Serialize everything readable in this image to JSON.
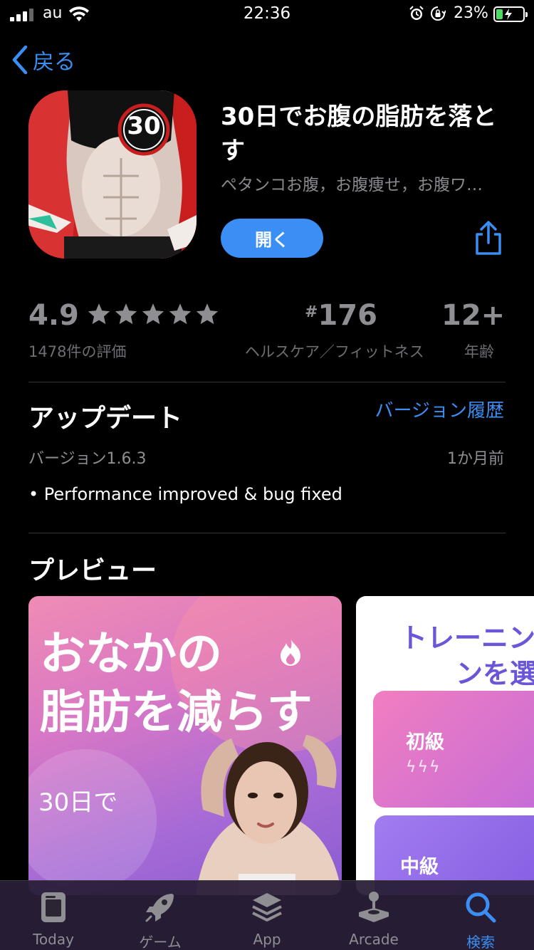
{
  "status_bar": {
    "carrier": "au",
    "time": "22:36",
    "battery_percent": "23%",
    "battery_level": 0.23,
    "icons": [
      "signal-icon",
      "wifi-icon",
      "alarm-icon",
      "rotation-lock-icon",
      "battery-charging-icon"
    ]
  },
  "nav": {
    "back_label": "戻る"
  },
  "app": {
    "icon_badge": "30",
    "title": "30日でお腹の脂肪を落とす",
    "subtitle": "ペタンコお腹，お腹痩せ，お腹ワ…",
    "open_label": "開く"
  },
  "stats": {
    "rating": "4.9",
    "stars": 5,
    "rating_count": "1478件の評価",
    "rank_hash": "#",
    "rank": "176",
    "rank_category": "ヘルスケア／フィットネス",
    "age": "12+",
    "age_label": "年齢"
  },
  "update": {
    "title": "アップデート",
    "history_link": "バージョン履歴",
    "version": "バージョン1.6.3",
    "updated": "1か月前",
    "notes": "• Performance improved & bug fixed"
  },
  "preview": {
    "title": "プレビュー",
    "card1": {
      "line1": "おなかの",
      "line2": "脂肪を減らす",
      "days": "30日で"
    },
    "card2": {
      "line1": "トレーニン",
      "line2": "ンを選",
      "level1": "初級",
      "level2": "中級",
      "bolts": "ϟϟϟ"
    }
  },
  "tabs": [
    {
      "label": "Today",
      "icon": "today-icon",
      "active": false
    },
    {
      "label": "ゲーム",
      "icon": "rocket-icon",
      "active": false
    },
    {
      "label": "App",
      "icon": "layers-icon",
      "active": false
    },
    {
      "label": "Arcade",
      "icon": "joystick-icon",
      "active": false
    },
    {
      "label": "検索",
      "icon": "search-icon",
      "active": true
    }
  ],
  "colors": {
    "accent": "#3b8ef3",
    "background": "#000000",
    "secondary_text": "#8e8e93",
    "battery_green": "#4cd964"
  }
}
